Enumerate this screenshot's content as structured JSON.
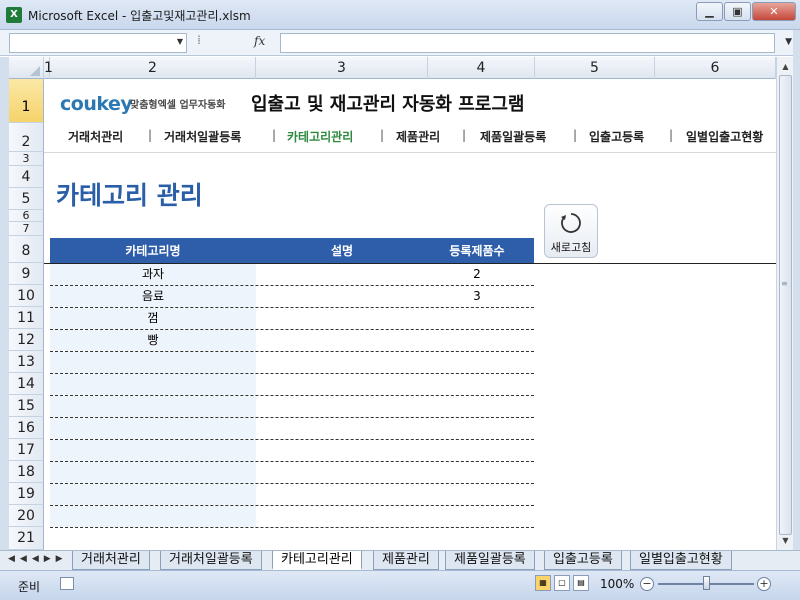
{
  "window": {
    "title": "Microsoft Excel - 입출고및재고관리.xlsm",
    "app_icon": "X",
    "minimize": "▁",
    "restore": "▣",
    "close": "✕"
  },
  "formula_bar": {
    "name_box": "",
    "fx": "fx",
    "content": ""
  },
  "columns": [
    "1",
    "2",
    "3",
    "4",
    "5",
    "6"
  ],
  "rows": [
    "1",
    "2",
    "3",
    "4",
    "5",
    "6",
    "7",
    "8",
    "9",
    "10",
    "11",
    "12",
    "13",
    "14",
    "15",
    "16",
    "17",
    "18",
    "19",
    "20",
    "21"
  ],
  "brand": {
    "logo": "coukey",
    "tagline": "맞춤형엑셀 업무자동화",
    "title": "입출고 및 재고관리 자동화 프로그램"
  },
  "nav": {
    "items": [
      "거래처관리",
      "거래처일괄등록",
      "카테고리관리",
      "제품관리",
      "제품일괄등록",
      "입출고등록",
      "일별입출고현황"
    ],
    "separator": "|",
    "active_index": 2
  },
  "section": {
    "title": "카테고리 관리",
    "refresh_label": "새로고침"
  },
  "table": {
    "headers": [
      "카테고리명",
      "설명",
      "등록제품수"
    ],
    "rows": [
      {
        "name": "과자",
        "desc": "",
        "count": "2"
      },
      {
        "name": "음료",
        "desc": "",
        "count": "3"
      },
      {
        "name": "껌",
        "desc": "",
        "count": ""
      },
      {
        "name": "빵",
        "desc": "",
        "count": ""
      },
      {
        "name": "",
        "desc": "",
        "count": ""
      },
      {
        "name": "",
        "desc": "",
        "count": ""
      },
      {
        "name": "",
        "desc": "",
        "count": ""
      },
      {
        "name": "",
        "desc": "",
        "count": ""
      },
      {
        "name": "",
        "desc": "",
        "count": ""
      },
      {
        "name": "",
        "desc": "",
        "count": ""
      },
      {
        "name": "",
        "desc": "",
        "count": ""
      },
      {
        "name": "",
        "desc": "",
        "count": ""
      }
    ]
  },
  "sheet_tabs": {
    "tabs": [
      "거래처관리",
      "거래처일괄등록",
      "카테고리관리",
      "제품관리",
      "제품일괄등록",
      "입출고등록",
      "일별입출고현황"
    ],
    "active_index": 2
  },
  "status": {
    "ready": "준비",
    "zoom": "100%"
  },
  "colors": {
    "header_blue": "#2e5ea9",
    "title_blue": "#2a5ea8",
    "active_nav_green": "#2b8a3e",
    "cell_fill": "#eef4fb"
  }
}
